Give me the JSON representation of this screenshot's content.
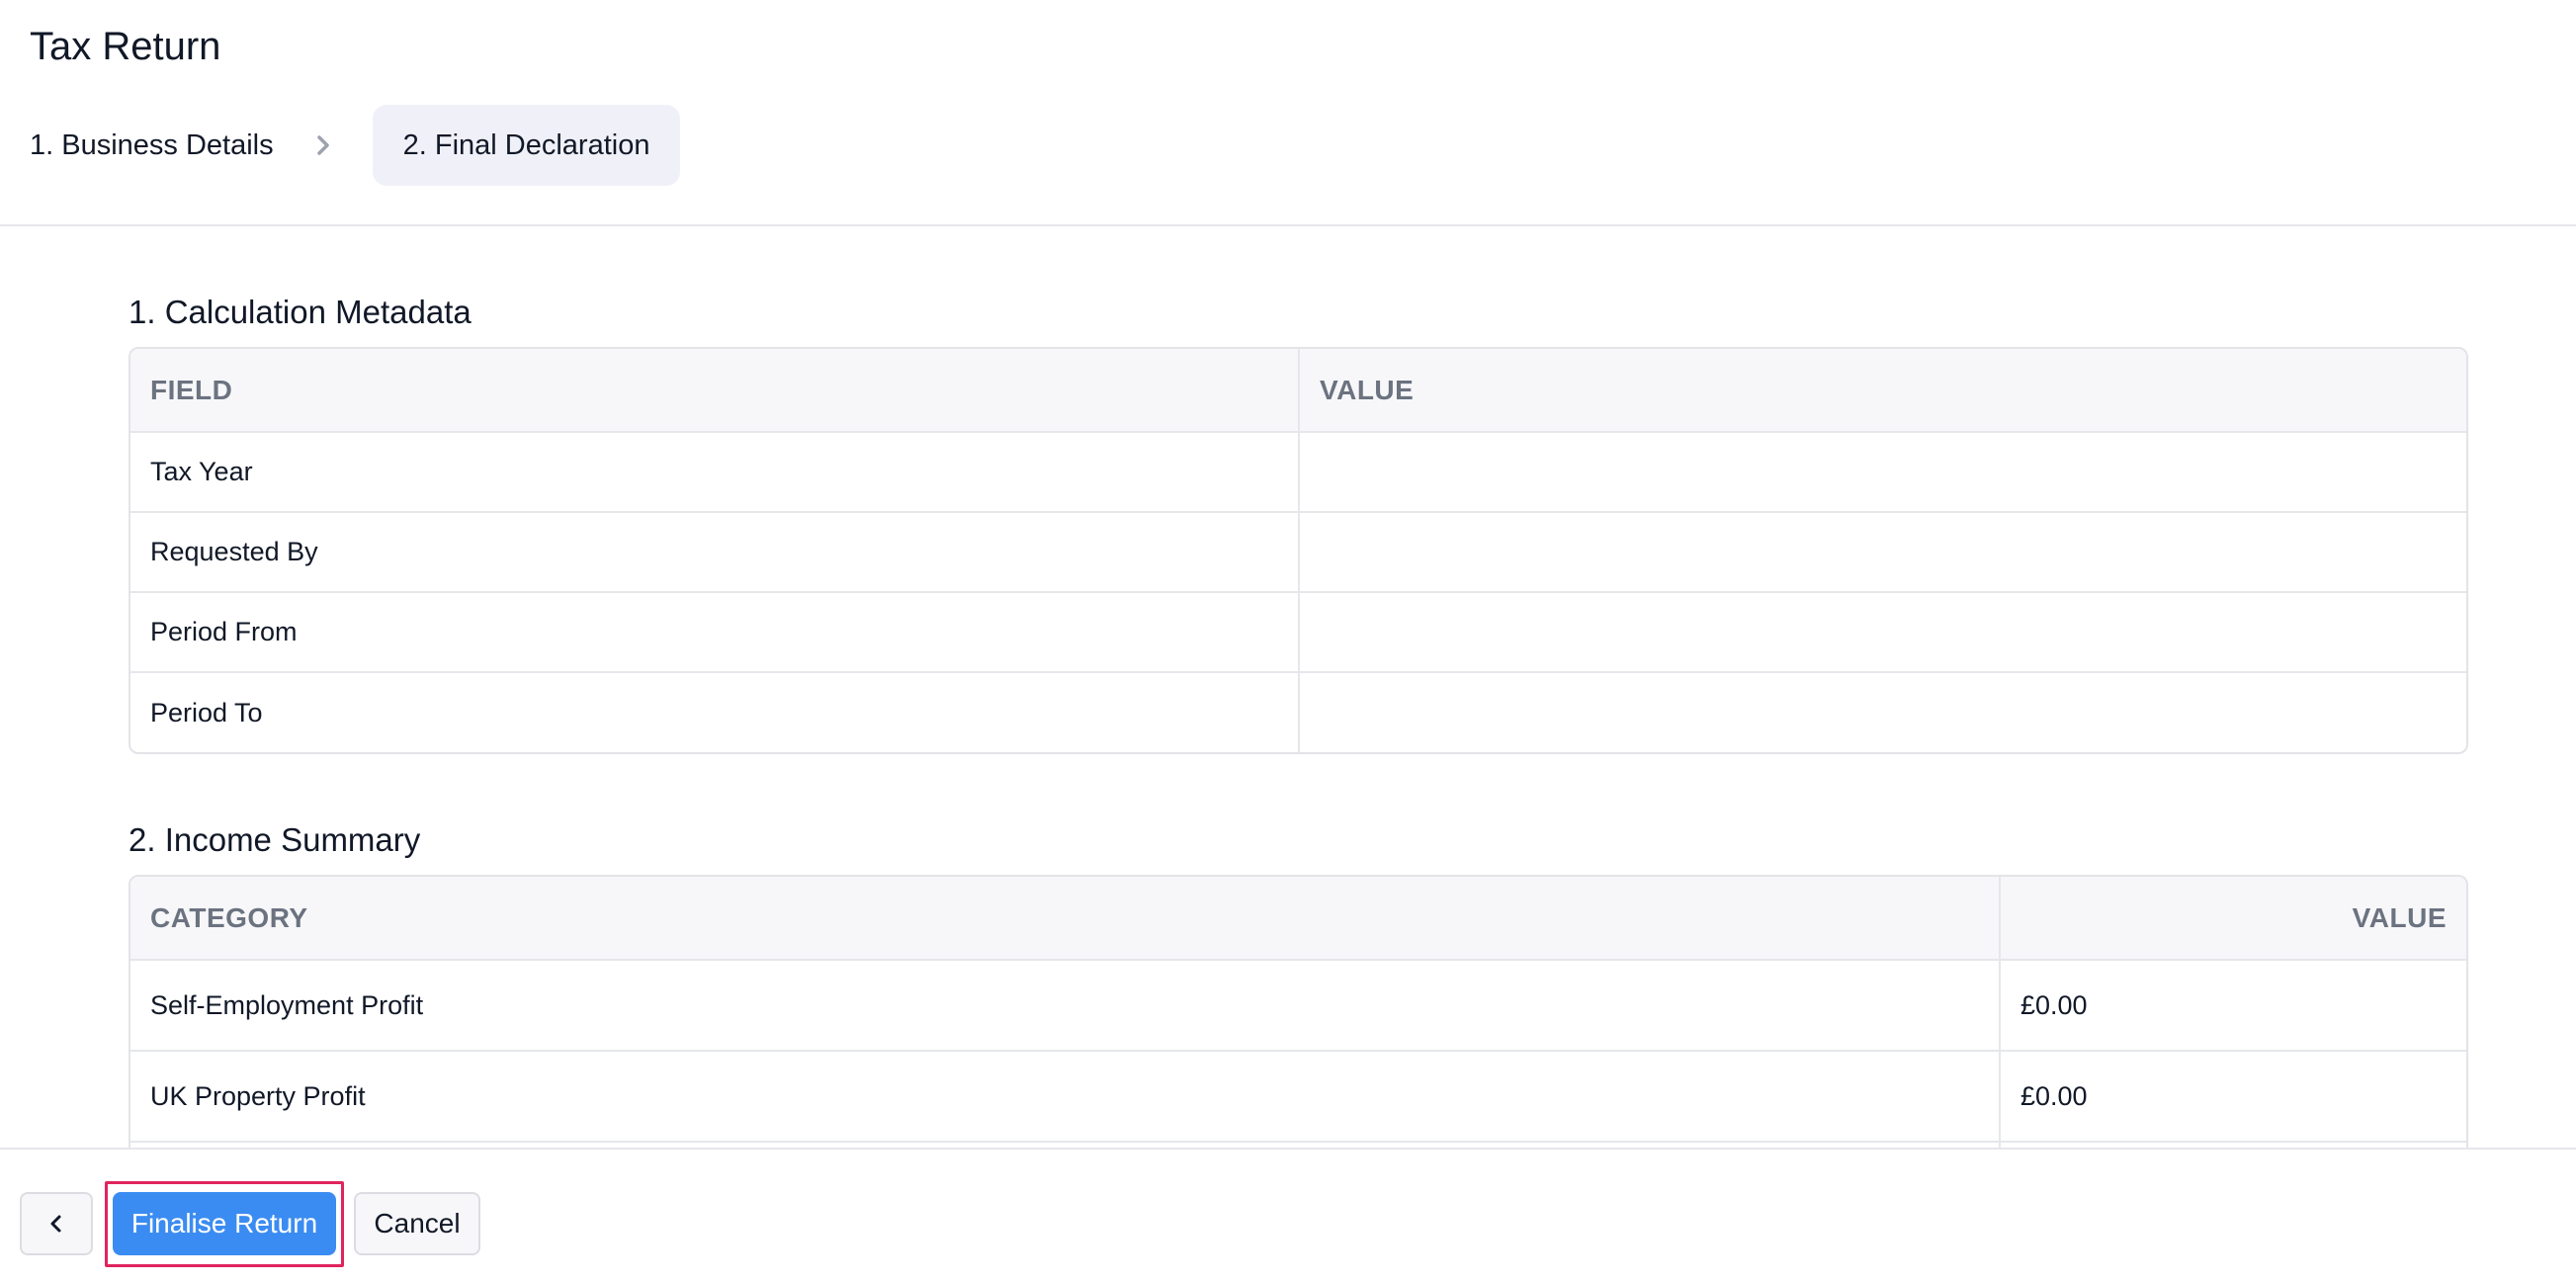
{
  "header": {
    "title": "Tax Return",
    "steps": [
      {
        "label": "1. Business Details",
        "active": false
      },
      {
        "label": "2. Final Declaration",
        "active": true
      }
    ]
  },
  "sections": {
    "metadata": {
      "title": "1. Calculation Metadata",
      "columns": [
        "FIELD",
        "VALUE"
      ],
      "rows": [
        {
          "field": "Tax Year",
          "value": ""
        },
        {
          "field": "Requested By",
          "value": ""
        },
        {
          "field": "Period From",
          "value": ""
        },
        {
          "field": "Period To",
          "value": ""
        }
      ]
    },
    "income": {
      "title": "2. Income Summary",
      "columns": [
        "CATEGORY",
        "VALUE"
      ],
      "rows": [
        {
          "category": "Self-Employment Profit",
          "value": "£0.00"
        },
        {
          "category": "UK Property Profit",
          "value": "£0.00"
        },
        {
          "category": "",
          "value": ""
        }
      ]
    }
  },
  "footer": {
    "back_icon": "chevron-left-icon",
    "finalise_label": "Finalise Return",
    "cancel_label": "Cancel"
  },
  "colors": {
    "primary": "#3b8cf2",
    "highlight": "#e0245e",
    "step_active_bg": "#f0f1f8"
  }
}
